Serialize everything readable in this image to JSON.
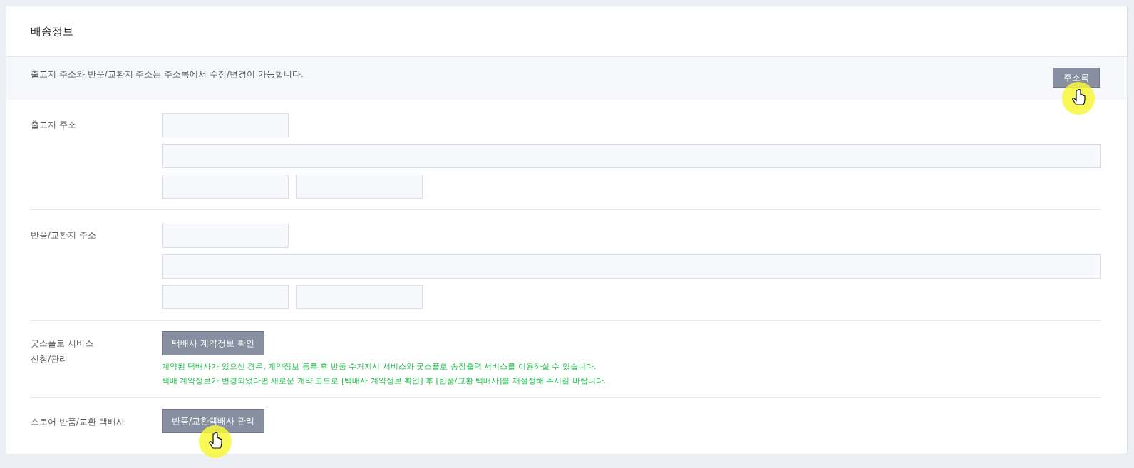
{
  "title": "배송정보",
  "notice": {
    "text": "출고지 주소와 반품/교환지 주소는 주소록에서 수정/변경이 가능합니다.",
    "button": "주소록",
    "pointer": true
  },
  "sections": [
    {
      "kind": "address",
      "label": "출고지 주소"
    },
    {
      "kind": "address",
      "label": "반품/교환지 주소"
    },
    {
      "kind": "action",
      "label": "굿스플로 서비스\n신청/관리",
      "button": "택배사 계약정보 확인",
      "pointer": false,
      "notes": [
        "계약된 택배사가 있으신 경우, 계약정보 등록 후 반품 수거지시 서비스와 굿스플로 송장출력 서비스를 이용하실 수 있습니다.",
        "택배 계약정보가 변경되었다면 새로운 계약 코드로 [택배사 계약정보 확인] 후 [반품/교환 택배사]를 재설정해 주시길 바랍니다."
      ]
    },
    {
      "kind": "action",
      "label": "스토어 반품/교환 택배사",
      "button": "반품/교환택배사 관리",
      "pointer": true
    }
  ]
}
